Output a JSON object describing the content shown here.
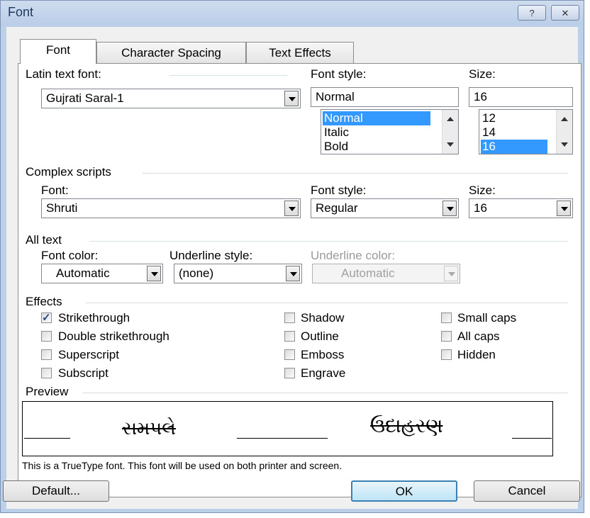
{
  "window": {
    "title": "Font",
    "help_glyph": "?",
    "close_glyph": "✕"
  },
  "tabs": [
    "Font",
    "Character Spacing",
    "Text Effects"
  ],
  "latin": {
    "font_label": "Latin text font:",
    "font_value": "Gujrati Saral-1",
    "style_label": "Font style:",
    "style_value": "Normal",
    "style_options": [
      "Normal",
      "Italic",
      "Bold"
    ],
    "style_selected": "Normal",
    "size_label": "Size:",
    "size_value": "16",
    "size_options": [
      "12",
      "14",
      "16"
    ],
    "size_selected": "16"
  },
  "complex": {
    "group_label": "Complex scripts",
    "font_label": "Font:",
    "font_value": "Shruti",
    "style_label": "Font style:",
    "style_value": "Regular",
    "size_label": "Size:",
    "size_value": "16"
  },
  "all_text": {
    "group_label": "All text",
    "font_color_label": "Font color:",
    "font_color_value": "Automatic",
    "underline_style_label": "Underline style:",
    "underline_style_value": "(none)",
    "underline_color_label": "Underline color:",
    "underline_color_value": "Automatic"
  },
  "effects": {
    "group_label": "Effects",
    "items": [
      {
        "label": "Strikethrough",
        "checked": true
      },
      {
        "label": "Double strikethrough",
        "checked": false
      },
      {
        "label": "Superscript",
        "checked": false
      },
      {
        "label": "Subscript",
        "checked": false
      },
      {
        "label": "Shadow",
        "checked": false
      },
      {
        "label": "Outline",
        "checked": false
      },
      {
        "label": "Emboss",
        "checked": false
      },
      {
        "label": "Engrave",
        "checked": false
      },
      {
        "label": "Small caps",
        "checked": false
      },
      {
        "label": "All caps",
        "checked": false
      },
      {
        "label": "Hidden",
        "checked": false
      }
    ]
  },
  "preview": {
    "group_label": "Preview",
    "sample_left": "સમપલે",
    "sample_right": "ઉદાહરણ",
    "note": "This is a TrueType font. This font will be used on both printer and screen."
  },
  "buttons": {
    "default": "Default...",
    "ok": "OK",
    "cancel": "Cancel"
  },
  "colors": {
    "selection": "#3399ff",
    "title_bar": "#bcd0ea",
    "dialog_bg": "#f0f0f0"
  }
}
